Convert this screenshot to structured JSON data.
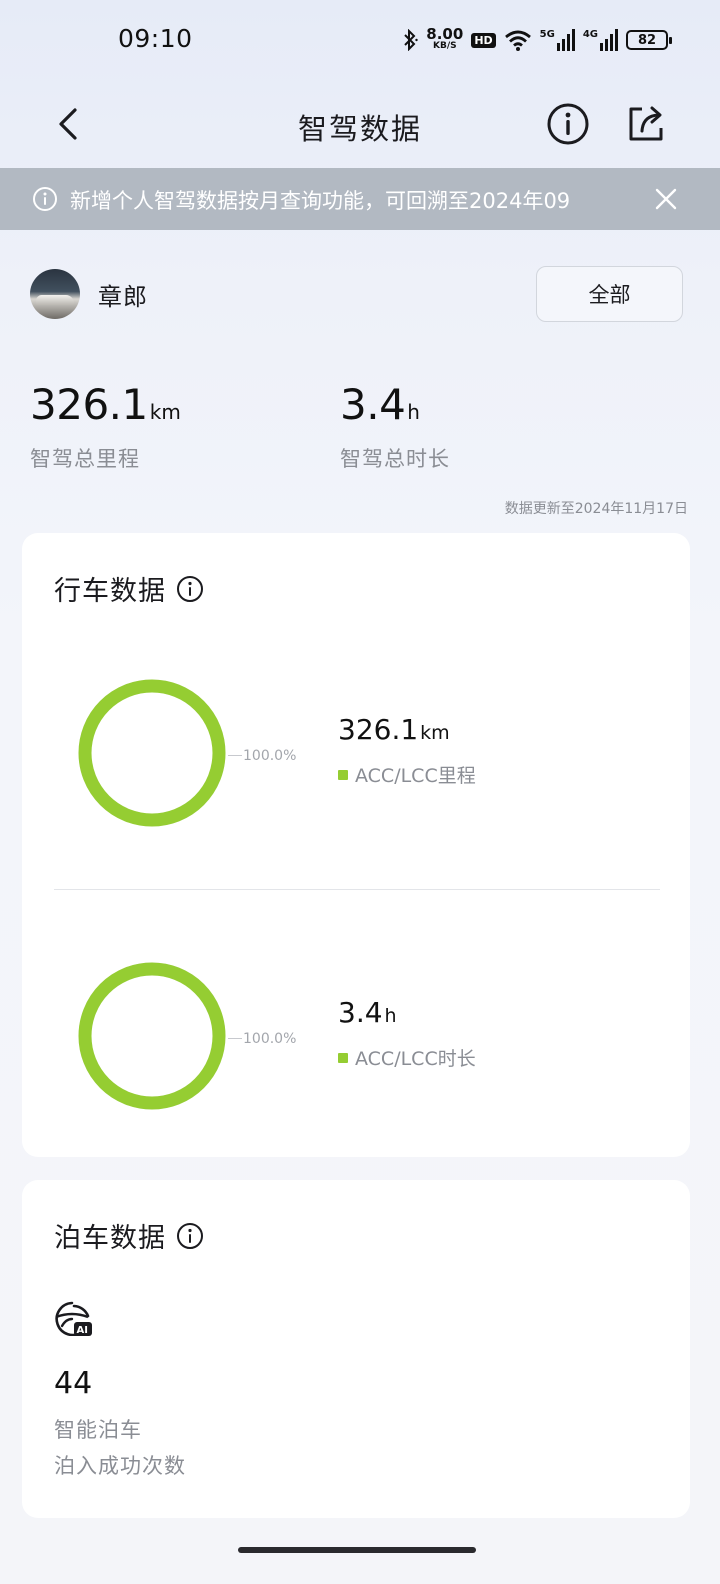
{
  "status_bar": {
    "time": "09:10",
    "net_speed": "8.00",
    "net_unit": "KB/S",
    "hd": "HD",
    "sig1": "5G",
    "sig2": "4G",
    "battery": "82"
  },
  "header": {
    "title": "智驾数据",
    "back_icon": "chevron-left-icon",
    "info_icon": "info-circle-icon",
    "share_icon": "share-icon"
  },
  "notice": {
    "text": "新增个人智驾数据按月查询功能，可回溯至2024年09",
    "close_icon": "close-icon"
  },
  "profile": {
    "name": "章郎",
    "filter_label": "全部"
  },
  "summary": {
    "distance_value": "326.1",
    "distance_unit": "km",
    "distance_label": "智驾总里程",
    "duration_value": "3.4",
    "duration_unit": "h",
    "duration_label": "智驾总时长",
    "updated": "数据更新至2024年11月17日"
  },
  "drive_card": {
    "title": "行车数据",
    "distance": {
      "percent": "100.0%",
      "value": "326.1",
      "unit": "km",
      "legend": "ACC/LCC里程",
      "fraction": 1.0
    },
    "duration": {
      "percent": "100.0%",
      "value": "3.4",
      "unit": "h",
      "legend": "ACC/LCC时长",
      "fraction": 1.0
    }
  },
  "park_card": {
    "title": "泊车数据",
    "icon": "ai-parking-icon",
    "count": "44",
    "label_1": "智能泊车",
    "label_2": "泊入成功次数"
  },
  "colors": {
    "accent_green": "#95cd32",
    "notice_bg": "#b2b9c2"
  }
}
